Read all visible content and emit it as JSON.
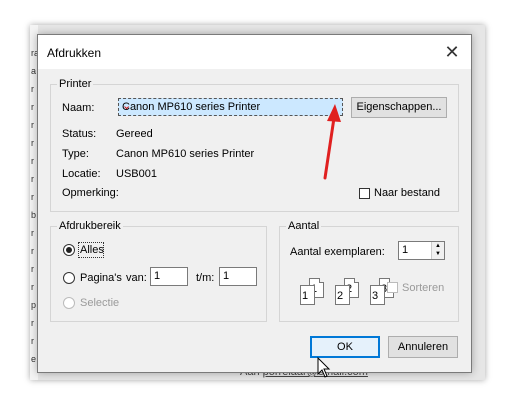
{
  "background": {
    "left_letters": [
      "ra",
      "a",
      "r",
      "r",
      "r",
      "r",
      "r",
      "r",
      "r",
      "b",
      "r",
      "r",
      "r",
      "r",
      "p",
      "r",
      "r",
      "e"
    ],
    "bottom_text_prefix": "Aan",
    "bottom_text_link": "porrelaar@email.com"
  },
  "dialog": {
    "title": "Afdrukken",
    "close_glyph": "✕",
    "printer": {
      "legend": "Printer",
      "name_label": "Naam:",
      "name_value": "Canon MP610 series Printer",
      "properties_button": "Eigenschappen...",
      "status_label": "Status:",
      "status_value": "Gereed",
      "type_label": "Type:",
      "type_value": "Canon MP610 series Printer",
      "location_label": "Locatie:",
      "location_value": "USB001",
      "comment_label": "Opmerking:",
      "print_to_file_label": "Naar bestand"
    },
    "range": {
      "legend": "Afdrukbereik",
      "all_label": "Alles",
      "pages_label": "Pagina's",
      "from_label": "van:",
      "from_value": "1",
      "to_label": "t/m:",
      "to_value": "1",
      "selection_label": "Selectie"
    },
    "copies": {
      "legend": "Aantal",
      "count_label": "Aantal exemplaren:",
      "count_value": "1",
      "collate_label": "Sorteren",
      "page_numbers": [
        "1",
        "1",
        "2",
        "2",
        "3",
        "3"
      ]
    },
    "ok_button": "OK",
    "cancel_button": "Annuleren"
  },
  "colors": {
    "selection_highlight": "#cce8ff",
    "default_button_border": "#0078d7",
    "annotation_arrow": "#e02020"
  }
}
